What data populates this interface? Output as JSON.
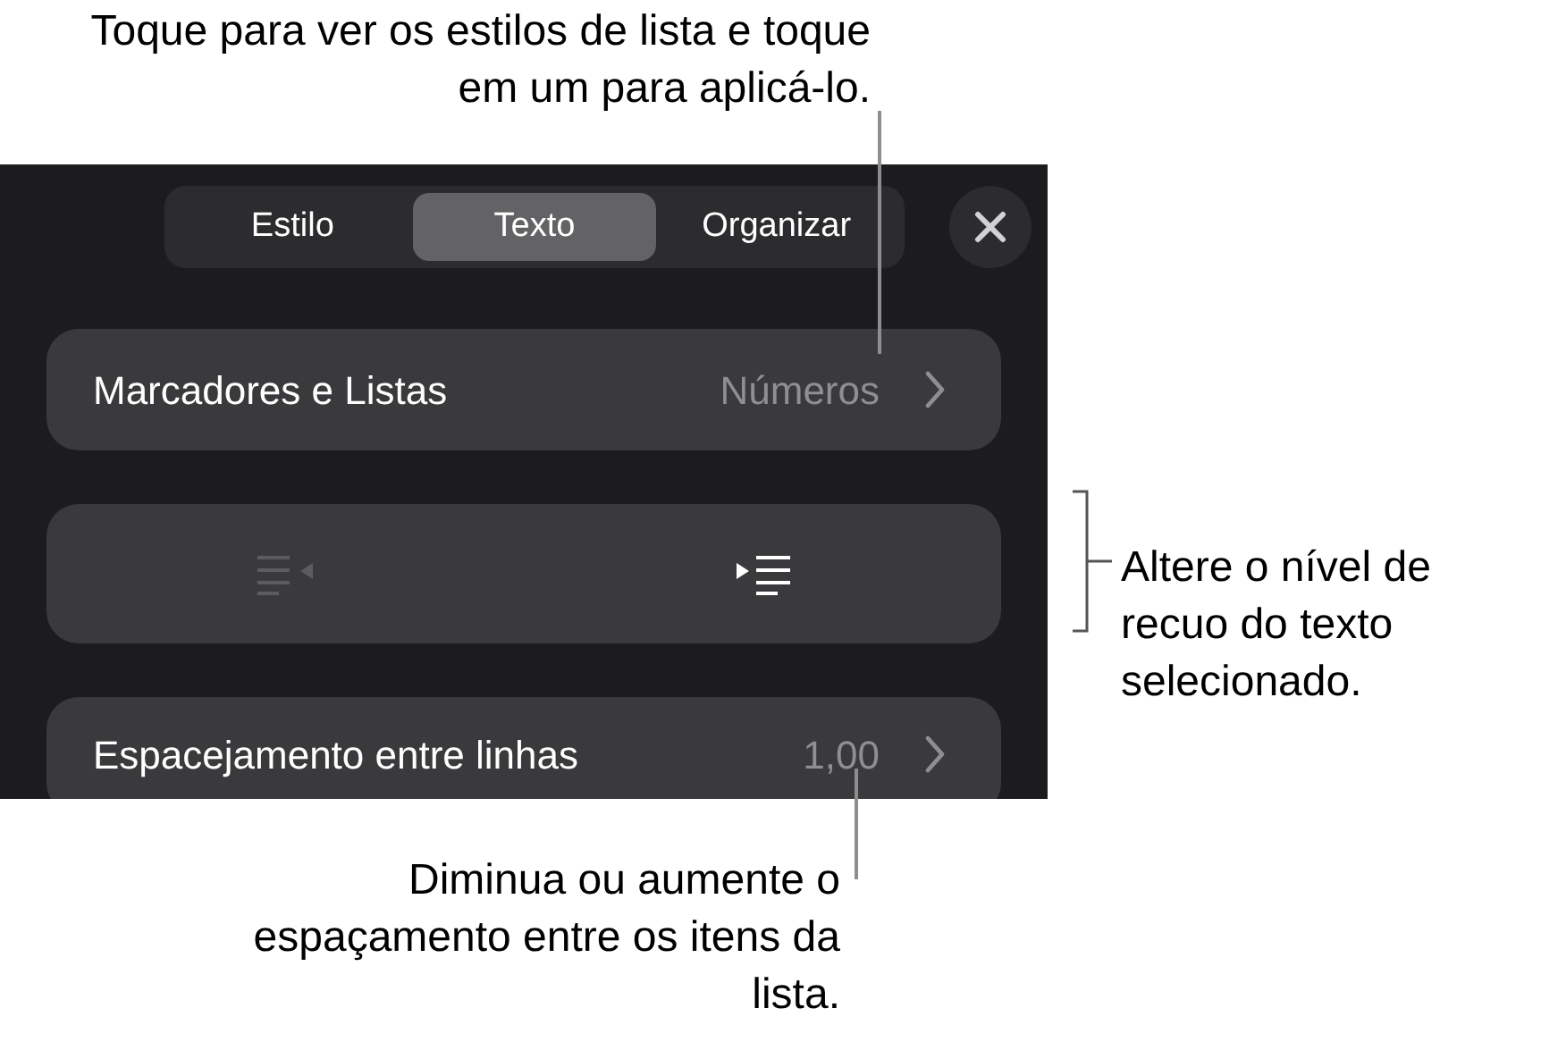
{
  "tabs": [
    {
      "label": "Estilo",
      "selected": false
    },
    {
      "label": "Texto",
      "selected": true
    },
    {
      "label": "Organizar",
      "selected": false
    }
  ],
  "rows": [
    {
      "kind": "link",
      "label": "Marcadores e Listas",
      "value": "Números"
    },
    {
      "kind": "indent",
      "buttons": [
        {
          "kind": "decrease",
          "disabled": true
        },
        {
          "kind": "increase",
          "disabled": false
        }
      ]
    },
    {
      "kind": "link",
      "label": "Espacejamento entre linhas",
      "value": "1,00"
    }
  ],
  "callouts": [
    {
      "kind": "top",
      "text": "Toque para ver os estilos de lista e toque em um para aplicá-lo."
    },
    {
      "kind": "right",
      "text": "Altere o nível de recuo do texto selecionado."
    },
    {
      "kind": "bottom",
      "text": "Diminua ou aumente o espaçamento entre os itens da lista."
    }
  ]
}
